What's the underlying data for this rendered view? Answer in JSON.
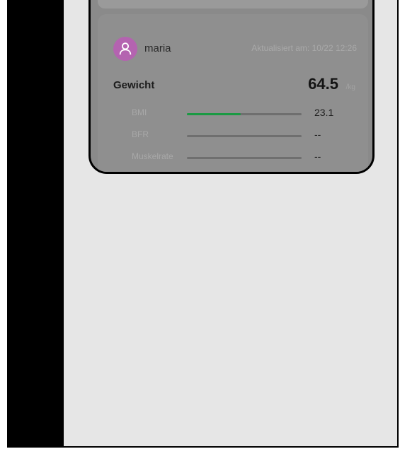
{
  "card": {
    "username": "maria",
    "updated": "Aktualisiert am: 10/22 12:26",
    "metric_label": "Gewicht",
    "metric_value": "64.5",
    "metric_unit": "/kg"
  },
  "rows": [
    {
      "label": "BMI",
      "value": "23.1",
      "progress": 0.47,
      "color": "#1a9a43"
    },
    {
      "label": "BFR",
      "value": "--",
      "progress": 0
    },
    {
      "label": "Muskelrate",
      "value": "--",
      "progress": 0
    }
  ],
  "icons": {
    "avatar": "user-icon"
  },
  "colors": {
    "avatar_bg": "#b463b0",
    "progress_fill": "#1a9a43"
  }
}
